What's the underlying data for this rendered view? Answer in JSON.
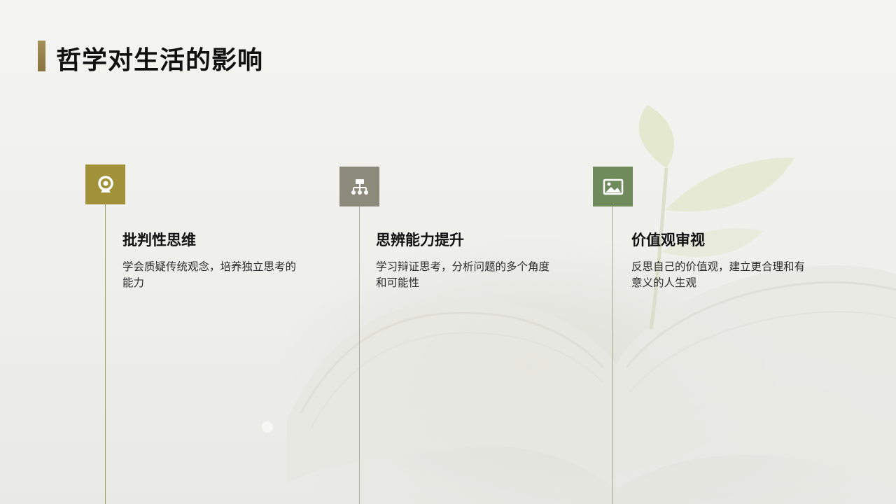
{
  "slide": {
    "title": "哲学对生活的影响"
  },
  "items": [
    {
      "title": "批判性思维",
      "description": "学会质疑传统观念，培养独立思考的能力",
      "icon": "webcam-icon",
      "color": "#a1923a"
    },
    {
      "title": "思辨能力提升",
      "description": "学习辩证思考，分析问题的多个角度和可能性",
      "icon": "hierarchy-icon",
      "color": "#8c8a7b"
    },
    {
      "title": "价值观审视",
      "description": "反思自己的价值观，建立更合理和有意义的人生观",
      "icon": "image-icon",
      "color": "#6f8a5b"
    }
  ],
  "colors": {
    "accent_bar": "#9c8750",
    "line_1": "#a8a060",
    "line_2": "#b0aea0",
    "line_3": "#9aa88a"
  }
}
